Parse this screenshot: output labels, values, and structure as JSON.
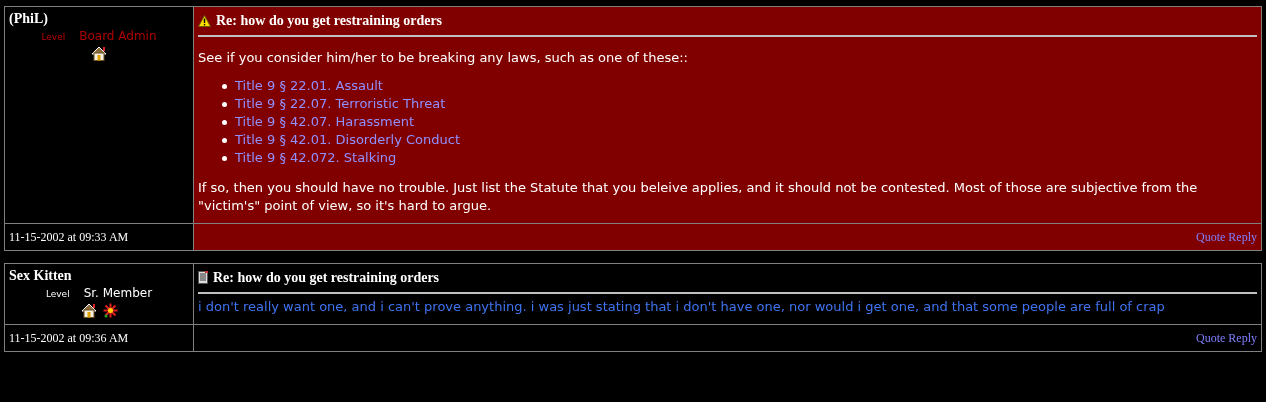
{
  "posts": [
    {
      "author": "(PhiL)",
      "level_label": "Level",
      "rank": "Board Admin",
      "staff": true,
      "badges": [
        {
          "kind": "house"
        }
      ],
      "date": "11-15-2002 at 09:33 AM",
      "highlighted": true,
      "title_icon": {
        "kind": "warning"
      },
      "title": "Re: how do you get restraining orders",
      "body": [
        {
          "kind": "paragraph",
          "text": "See if you consider him/her to be breaking any laws, such as one of these::"
        },
        {
          "kind": "list",
          "items": [
            "Title 9 § 22.01. Assault",
            "Title 9 § 22.07. Terroristic Threat",
            "Title 9 § 42.07. Harassment",
            "Title 9 § 42.01. Disorderly Conduct",
            "Title 9 § 42.072. Stalking"
          ]
        },
        {
          "kind": "paragraph",
          "text": "If so, then you should have no trouble. Just list the Statute that you beleive applies, and it should not be contested. Most of those are subjective from the \"victim's\" point of view, so it's hard to argue."
        }
      ],
      "action": "Quote Reply"
    },
    {
      "author": "Sex Kitten",
      "level_label": "Level",
      "rank": "Sr. Member",
      "staff": false,
      "badges": [
        {
          "kind": "house"
        },
        {
          "kind": "flower"
        }
      ],
      "date": "11-15-2002 at 09:36 AM",
      "highlighted": false,
      "title_icon": {
        "kind": "note"
      },
      "title": "Re: how do you get restraining orders",
      "body": [
        {
          "kind": "tinted",
          "text": "i don't really want one, and i can't prove anything. i was just stating that i don't have one, nor would i get one, and that some people are full of crap"
        }
      ],
      "action": "Quote Reply"
    }
  ]
}
